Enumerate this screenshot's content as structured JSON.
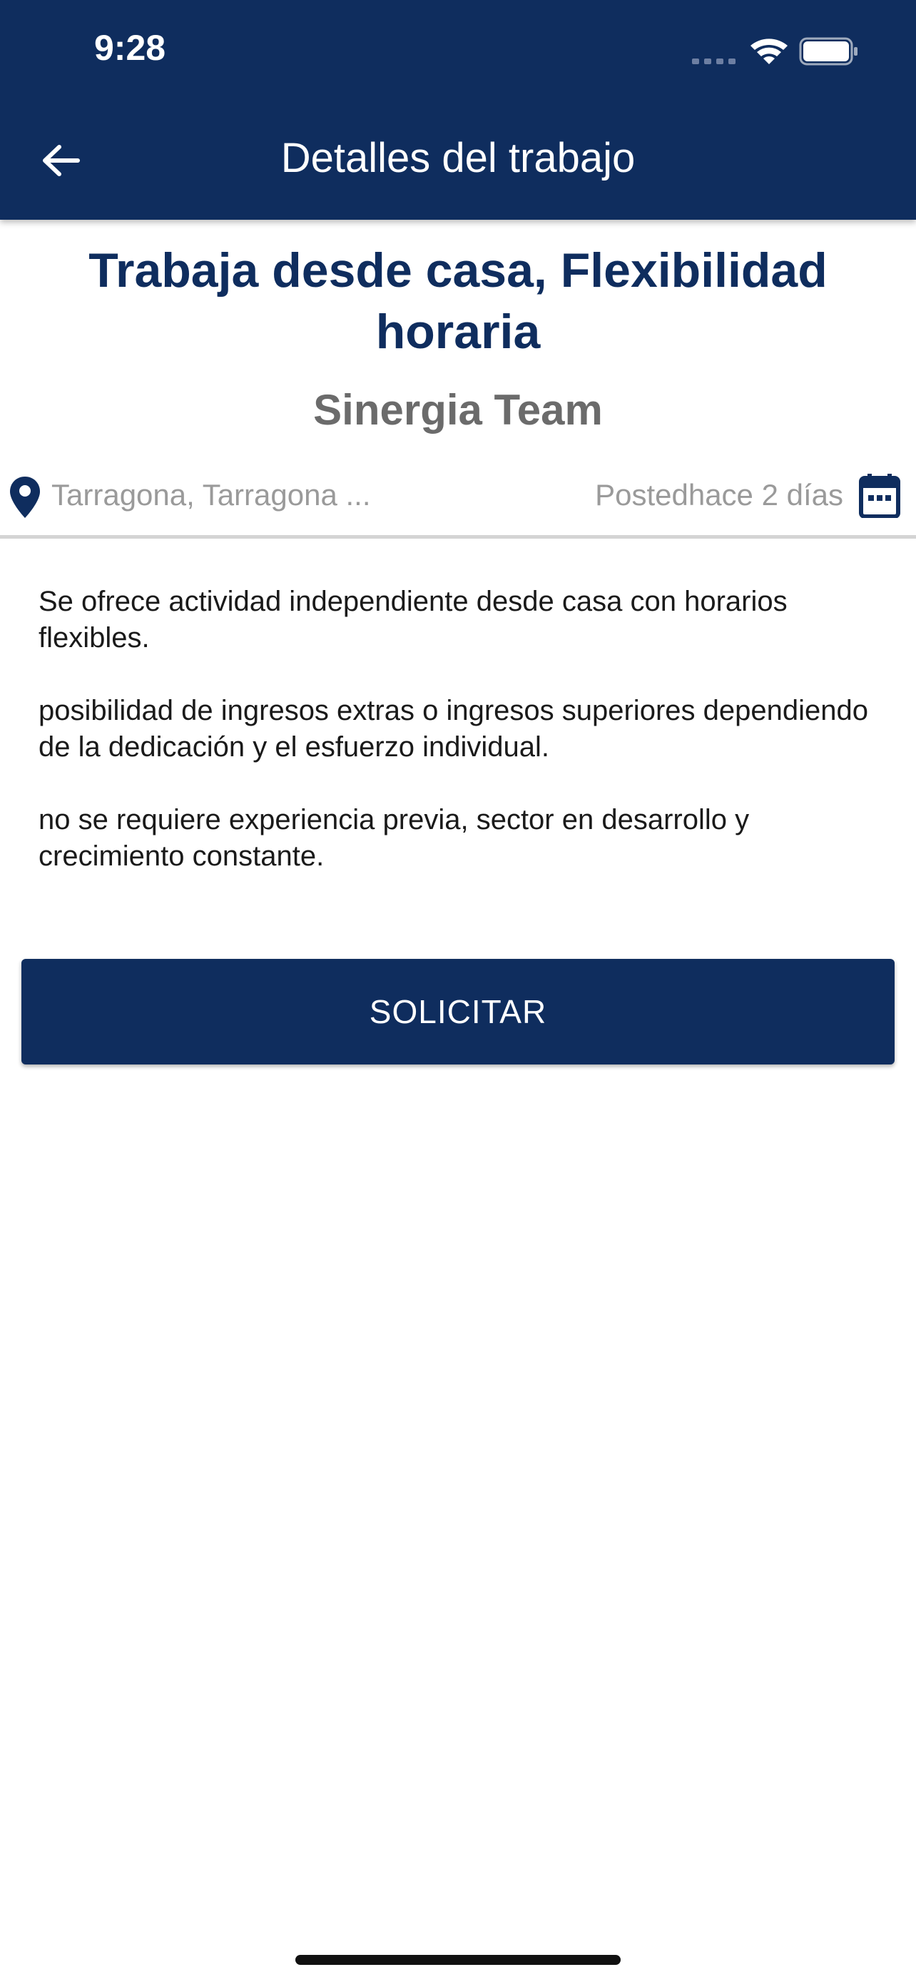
{
  "status_bar": {
    "time": "9:28"
  },
  "header": {
    "title": "Detalles del trabajo",
    "back_icon": "arrow-left-icon"
  },
  "job": {
    "title": "Trabaja desde casa, Flexibilidad horaria",
    "company": "Sinergia Team",
    "location": "Tarragona, Tarragona ...",
    "posted": "Postedhace 2 días",
    "description": [
      "Se ofrece actividad independiente desde casa con horarios flexibles.",
      "posibilidad de ingresos extras o ingresos superiores dependiendo de la dedicación y el esfuerzo individual.",
      "no se requiere experiencia previa, sector en desarrollo y crecimiento constante."
    ]
  },
  "actions": {
    "apply_label": "SOLICITAR"
  },
  "colors": {
    "primary": "#0f2d5e",
    "muted_text": "#9a9a9a",
    "company_text": "#6b6b6b",
    "divider": "#d4d4d4"
  }
}
